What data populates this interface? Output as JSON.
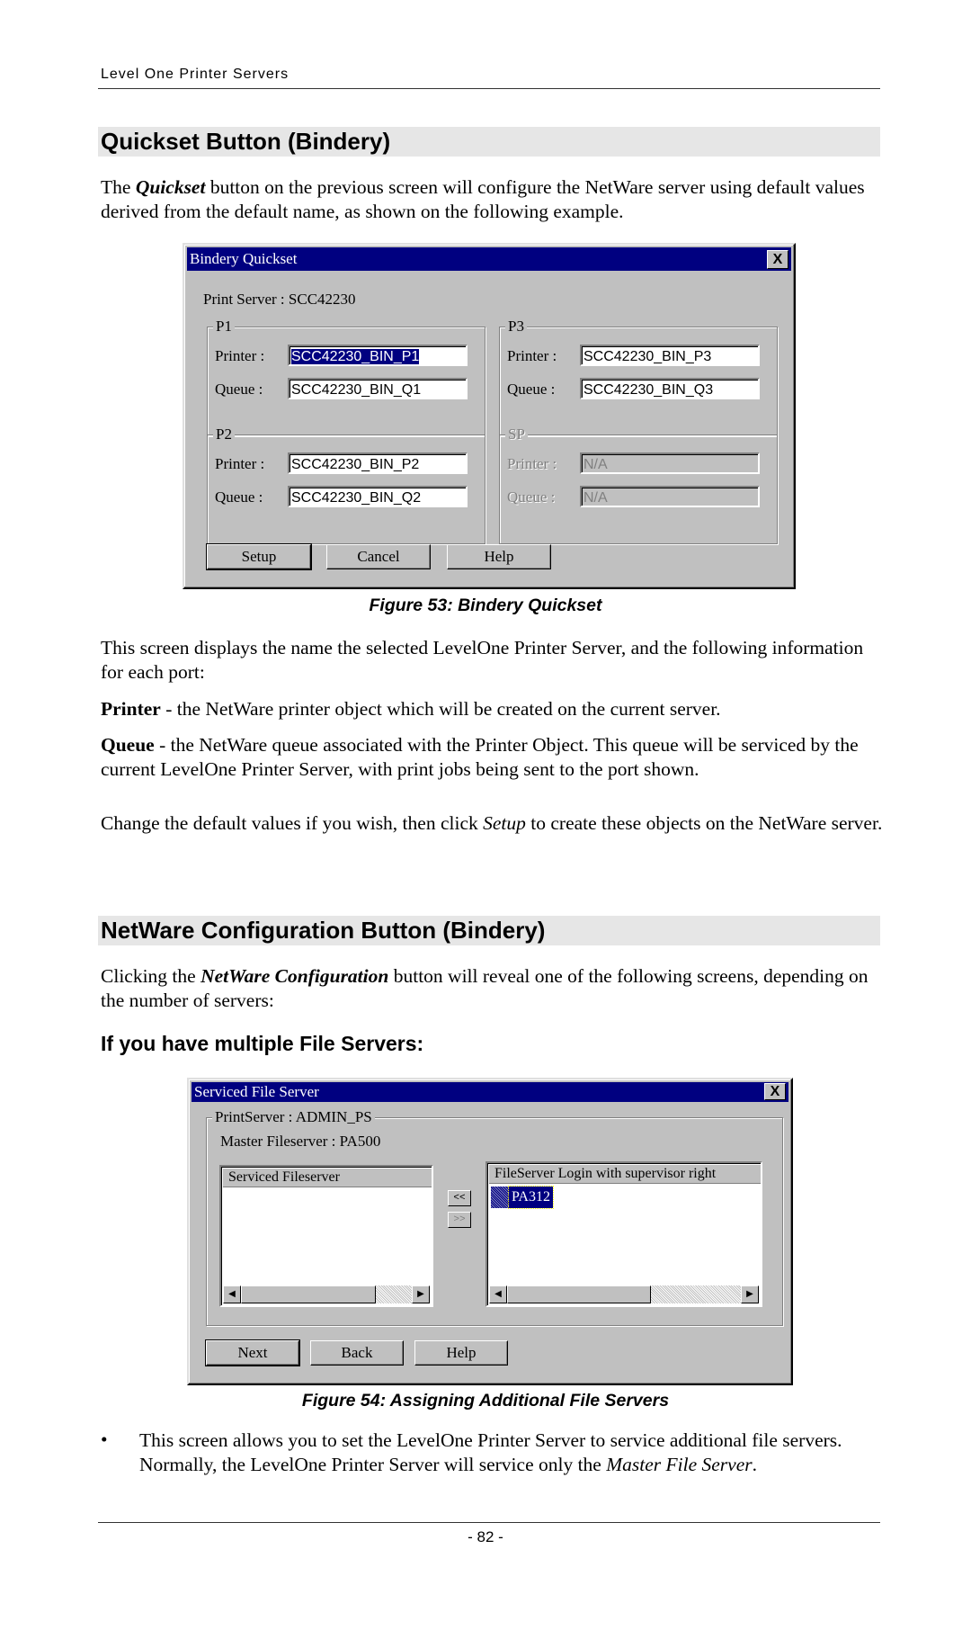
{
  "header": {
    "running_title": "Level One Printer Servers"
  },
  "section1": {
    "heading": "Quickset Button (Bindery)",
    "intro": {
      "pre": "The ",
      "bold_italic": "Quickset",
      "post": " button on the previous screen will configure the NetWare server using default values derived from the default name, as shown on the following example."
    }
  },
  "dialog1": {
    "title": "Bindery Quickset",
    "close_glyph": "X",
    "print_server_label": "Print Server : SCC42230",
    "groups": [
      {
        "label": "P1",
        "printer_label": "Printer :",
        "printer_value": "SCC42230_BIN_P1",
        "queue_label": "Queue :",
        "queue_value": "SCC42230_BIN_Q1",
        "enabled": true
      },
      {
        "label": "P3",
        "printer_label": "Printer :",
        "printer_value": "SCC42230_BIN_P3",
        "queue_label": "Queue :",
        "queue_value": "SCC42230_BIN_Q3",
        "enabled": true
      },
      {
        "label": "P2",
        "printer_label": "Printer :",
        "printer_value": "SCC42230_BIN_P2",
        "queue_label": "Queue :",
        "queue_value": "SCC42230_BIN_Q2",
        "enabled": true
      },
      {
        "label": "SP",
        "printer_label": "Printer :",
        "printer_value": "N/A",
        "queue_label": "Queue :",
        "queue_value": "N/A",
        "enabled": false
      }
    ],
    "buttons": {
      "setup": "Setup",
      "cancel": "Cancel",
      "help": "Help"
    }
  },
  "figure53_caption": "Figure 53: Bindery Quickset",
  "section1_body": {
    "p1": "This screen displays the name the selected LevelOne Printer Server, and the following information for each port:",
    "printer_term": "Printer",
    "printer_def": " - the NetWare printer object which will be created on the current server.",
    "queue_term": "Queue",
    "queue_def": " - the NetWare queue associated with the Printer Object. This queue will be serviced by the current LevelOne Printer Server, with print jobs being sent to the port shown.",
    "change": {
      "pre": "Change the default values if you wish, then click ",
      "italic": "Setup",
      "post": " to create these objects on the NetWare server."
    }
  },
  "section2": {
    "heading": "NetWare Configuration Button (Bindery)",
    "intro": {
      "pre": "Clicking the ",
      "bold_italic": "NetWare Configuration",
      "post": " button will reveal one of the following screens, depending on the number of servers:"
    },
    "subheading": "If you have multiple File Servers:"
  },
  "dialog2": {
    "title": "Serviced File Server",
    "close_glyph": "X",
    "group_label": "PrintServer : ADMIN_PS",
    "master_label": "Master Fileserver : PA500",
    "left_list": {
      "header": "Serviced Fileserver",
      "items": []
    },
    "right_list": {
      "header": "FileServer Login with supervisor right",
      "items": [
        "PA312"
      ]
    },
    "move_left_glyph": "<<",
    "move_right_glyph": ">>",
    "buttons": {
      "next": "Next",
      "back": "Back",
      "help": "Help"
    }
  },
  "figure54_caption": "Figure 54: Assigning Additional File Servers",
  "bullet": {
    "glyph": "•",
    "pre": "This screen allows you to set the LevelOne Printer Server to service additional file servers. Normally, the LevelOne Printer Server will service only the ",
    "italic": "Master File Server",
    "post": "."
  },
  "footer": {
    "page_number": "- 82 -"
  }
}
